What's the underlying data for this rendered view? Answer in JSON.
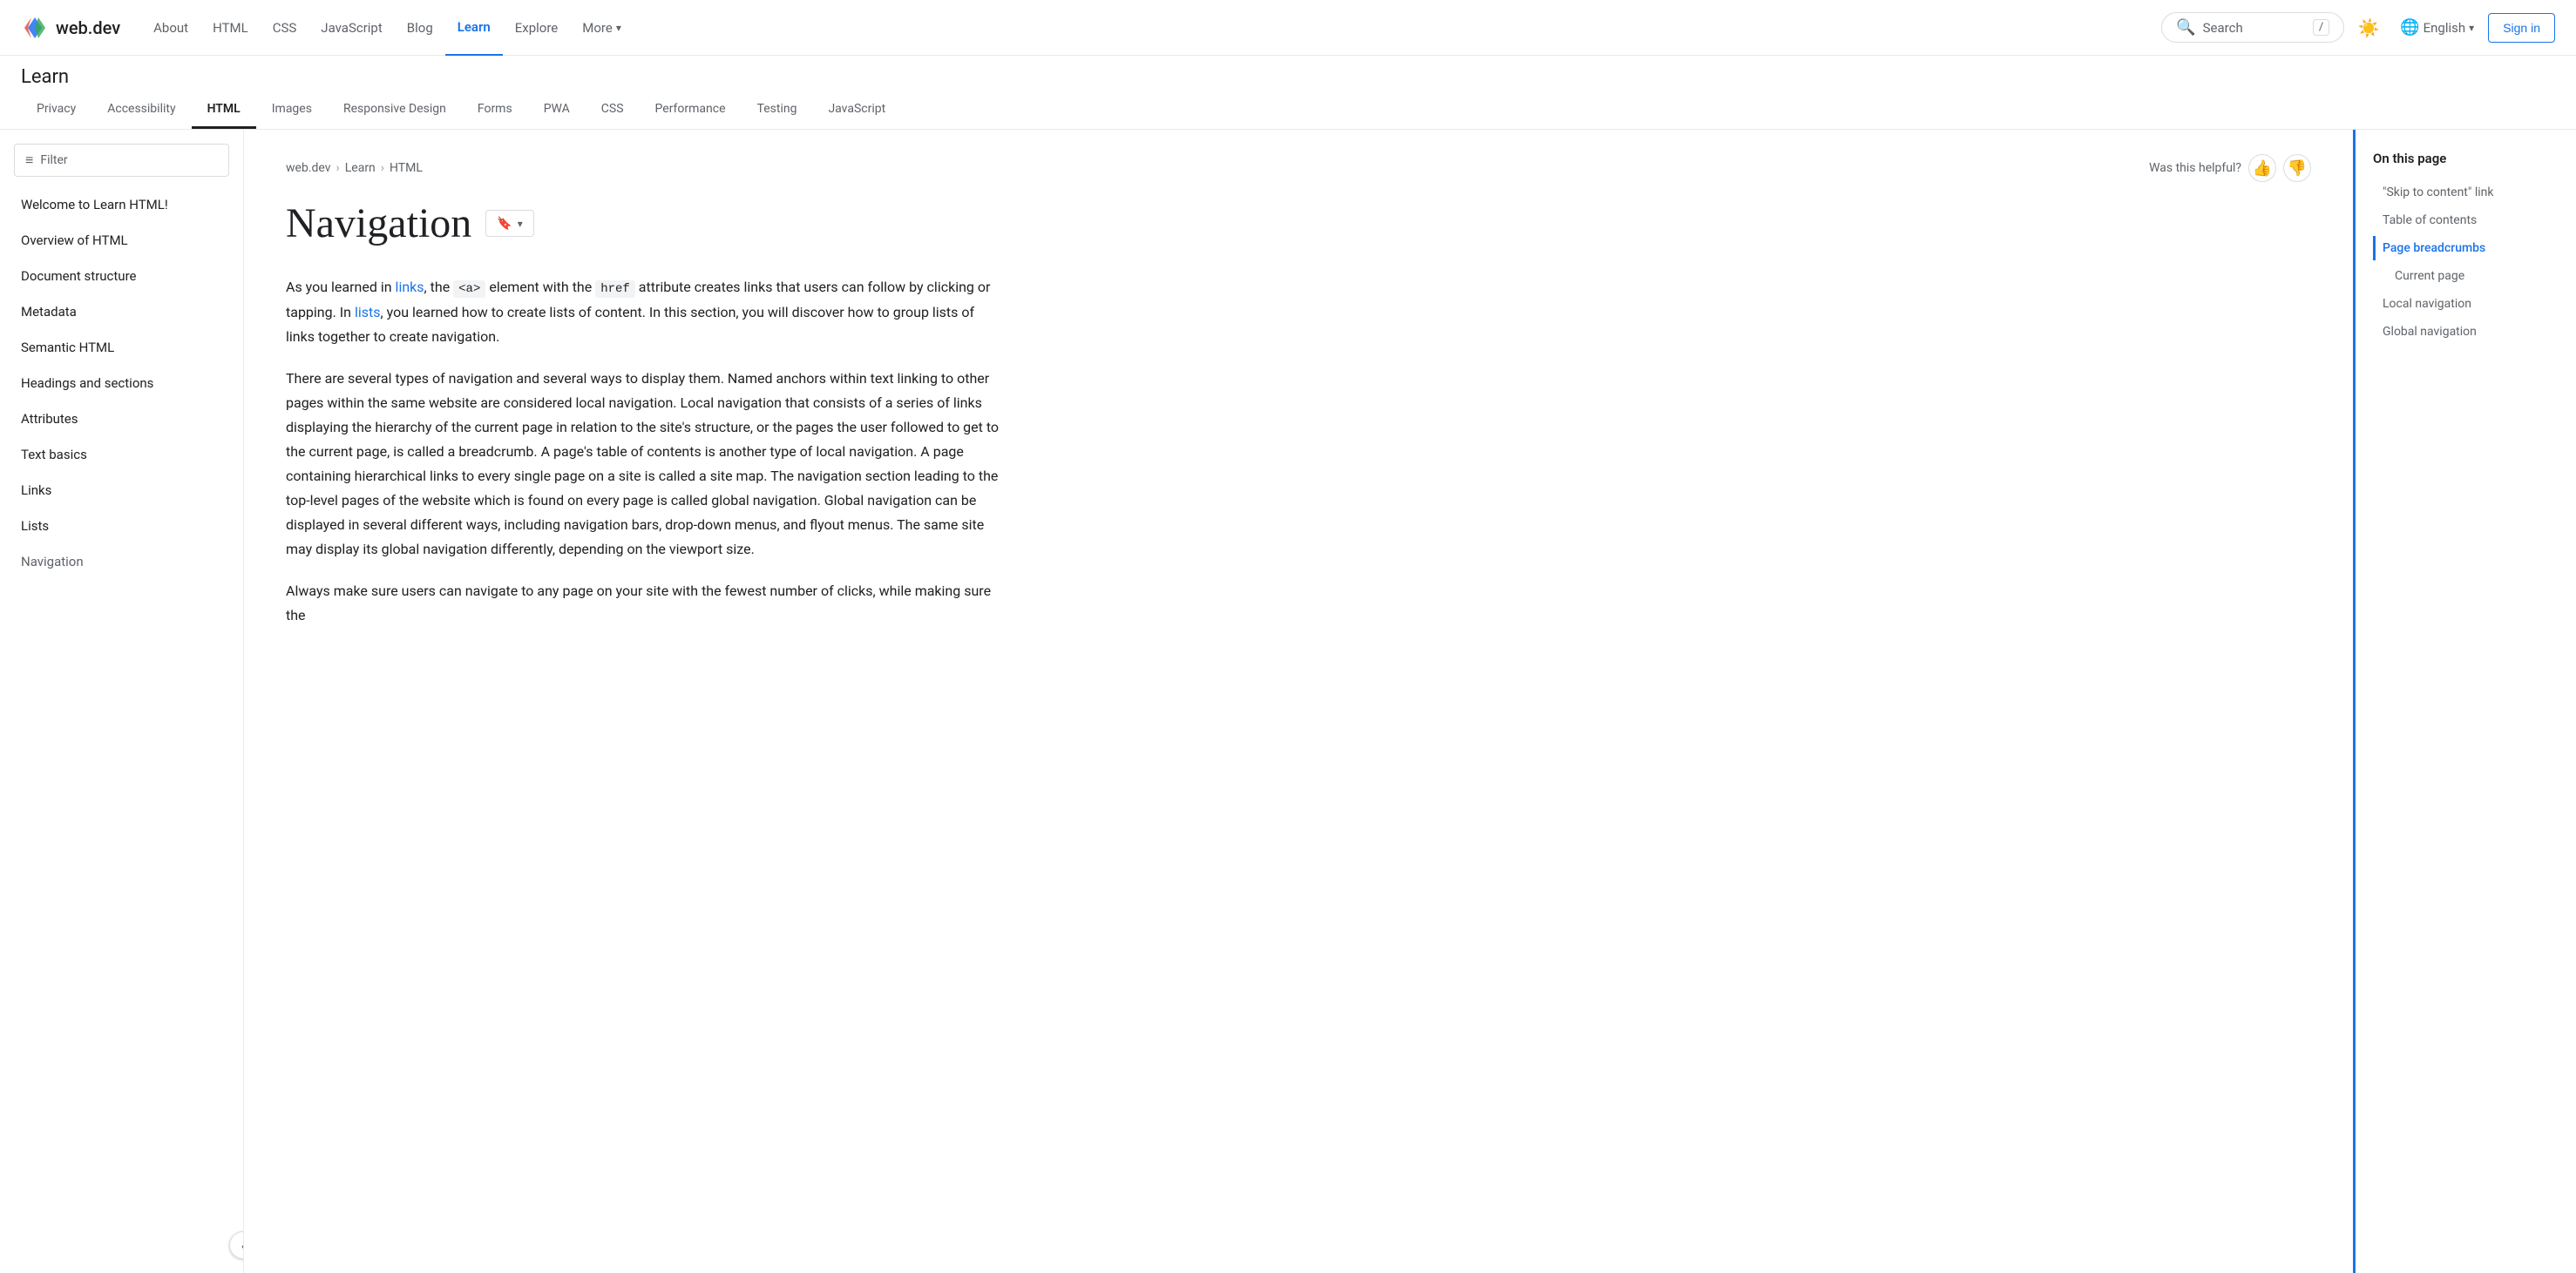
{
  "topnav": {
    "logo_text": "web.dev",
    "links": [
      {
        "label": "About",
        "active": false
      },
      {
        "label": "HTML",
        "active": false
      },
      {
        "label": "CSS",
        "active": false
      },
      {
        "label": "JavaScript",
        "active": false
      },
      {
        "label": "Blog",
        "active": false
      },
      {
        "label": "Learn",
        "active": true
      },
      {
        "label": "Explore",
        "active": false
      },
      {
        "label": "More",
        "active": false,
        "has_dropdown": true
      }
    ],
    "search_placeholder": "Search",
    "search_shortcut": "/",
    "language": "English",
    "signin_label": "Sign in"
  },
  "learn_header": {
    "title": "Learn",
    "tabs": [
      {
        "label": "Privacy",
        "active": false
      },
      {
        "label": "Accessibility",
        "active": false
      },
      {
        "label": "HTML",
        "active": true
      },
      {
        "label": "Images",
        "active": false
      },
      {
        "label": "Responsive Design",
        "active": false
      },
      {
        "label": "Forms",
        "active": false
      },
      {
        "label": "PWA",
        "active": false
      },
      {
        "label": "CSS",
        "active": false
      },
      {
        "label": "Performance",
        "active": false
      },
      {
        "label": "Testing",
        "active": false
      },
      {
        "label": "JavaScript",
        "active": false
      }
    ]
  },
  "sidebar": {
    "filter_label": "Filter",
    "items": [
      {
        "label": "Welcome to Learn HTML!",
        "active": false
      },
      {
        "label": "Overview of HTML",
        "active": false
      },
      {
        "label": "Document structure",
        "active": false
      },
      {
        "label": "Metadata",
        "active": false
      },
      {
        "label": "Semantic HTML",
        "active": false
      },
      {
        "label": "Headings and sections",
        "active": false
      },
      {
        "label": "Attributes",
        "active": false
      },
      {
        "label": "Text basics",
        "active": false
      },
      {
        "label": "Links",
        "active": false
      },
      {
        "label": "Lists",
        "active": false
      },
      {
        "label": "Navigation",
        "active": true
      }
    ],
    "collapse_icon": "‹"
  },
  "breadcrumb": {
    "items": [
      {
        "label": "web.dev"
      },
      {
        "label": "Learn"
      },
      {
        "label": "HTML"
      }
    ]
  },
  "helpful": {
    "label": "Was this helpful?",
    "thumbs_up": "👍",
    "thumbs_down": "👎"
  },
  "page": {
    "title": "Navigation",
    "bookmark_icon": "🔖",
    "bookmark_dropdown": "▾",
    "paragraphs": [
      {
        "id": "p1",
        "text": "As you learned in {links}, the {a} element with the {href} attribute creates links that users can follow by clicking or tapping. In {lists}, you learned how to create lists of content. In this section, you will discover how to group lists of links together to create navigation."
      },
      {
        "id": "p2",
        "text": "There are several types of navigation and several ways to display them. Named anchors within text linking to other pages within the same website are considered local navigation. Local navigation that consists of a series of links displaying the hierarchy of the current page in relation to the site's structure, or the pages the user followed to get to the current page, is called a breadcrumb. A page's table of contents is another type of local navigation. A page containing hierarchical links to every single page on a site is called a site map. The navigation section leading to the top-level pages of the website which is found on every page is called global navigation. Global navigation can be displayed in several different ways, including navigation bars, drop-down menus, and flyout menus. The same site may display its global navigation differently, depending on the viewport size."
      },
      {
        "id": "p3",
        "text": "Always make sure users can navigate to any page on your site with the fewest number of clicks, while making sure the"
      }
    ]
  },
  "on_this_page": {
    "title": "On this page",
    "items": [
      {
        "label": "\"Skip to content\" link",
        "active": false,
        "sub": false
      },
      {
        "label": "Table of contents",
        "active": false,
        "sub": false
      },
      {
        "label": "Page breadcrumbs",
        "active": true,
        "sub": false
      },
      {
        "label": "Current page",
        "active": false,
        "sub": true
      },
      {
        "label": "Local navigation",
        "active": false,
        "sub": false
      },
      {
        "label": "Global navigation",
        "active": false,
        "sub": false
      }
    ]
  }
}
